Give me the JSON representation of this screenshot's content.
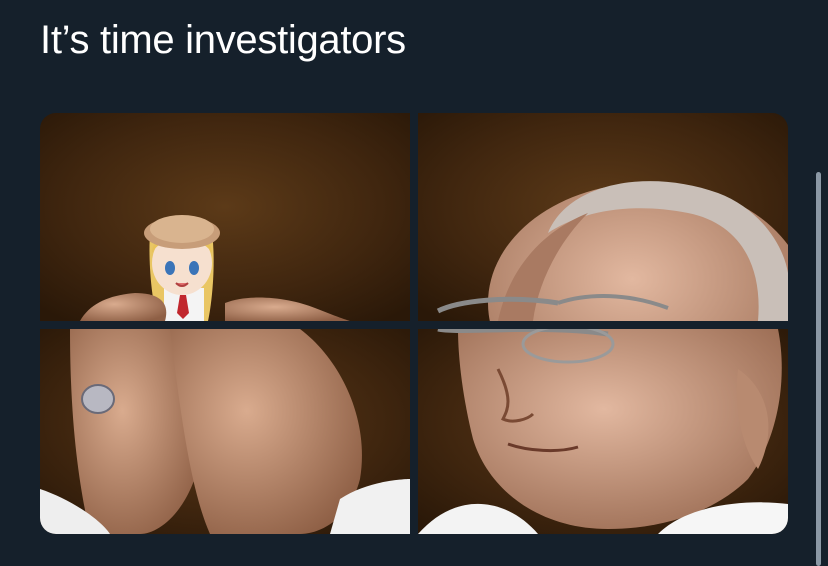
{
  "tweet": {
    "text": "It’s time investigators"
  },
  "media": {
    "tiles": [
      {
        "position": "top-left",
        "description_icon": "photo-icon"
      },
      {
        "position": "top-right",
        "description_icon": "photo-icon"
      },
      {
        "position": "bottom-left",
        "description_icon": "photo-icon"
      },
      {
        "position": "bottom-right",
        "description_icon": "photo-icon"
      }
    ]
  },
  "colors": {
    "background": "#15202b",
    "text": "#ffffff",
    "photo_backdrop": "#4a2c12",
    "scrollbar": "#8b98a5"
  }
}
